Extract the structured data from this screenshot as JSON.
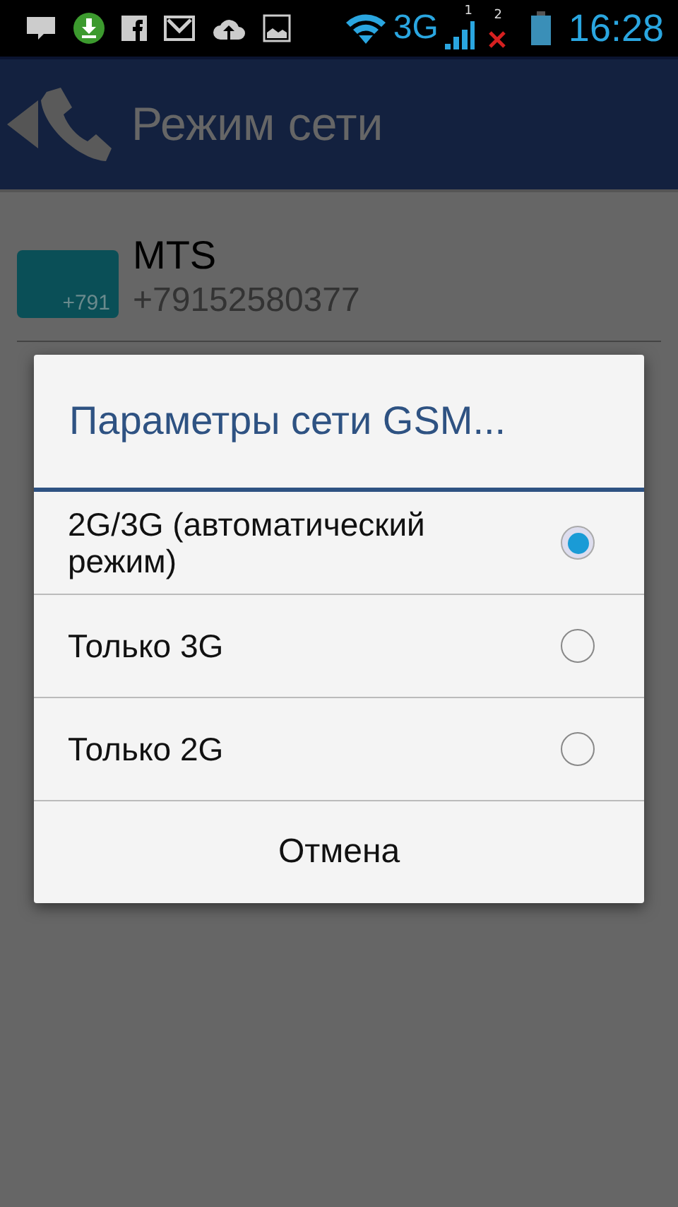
{
  "status_bar": {
    "network_type": "3G",
    "sim_1_label": "1",
    "sim_2_label": "2",
    "time": "16:28"
  },
  "action_bar": {
    "title": "Режим сети"
  },
  "sim_card": {
    "badge": "+791",
    "name": "MTS",
    "number": "+79152580377"
  },
  "dialog": {
    "title": "Параметры сети GSM...",
    "options": [
      {
        "label": "2G/3G (автоматический режим)",
        "selected": true
      },
      {
        "label": "Только 3G",
        "selected": false
      },
      {
        "label": "Только 2G",
        "selected": false
      }
    ],
    "cancel_button": "Отмена"
  }
}
